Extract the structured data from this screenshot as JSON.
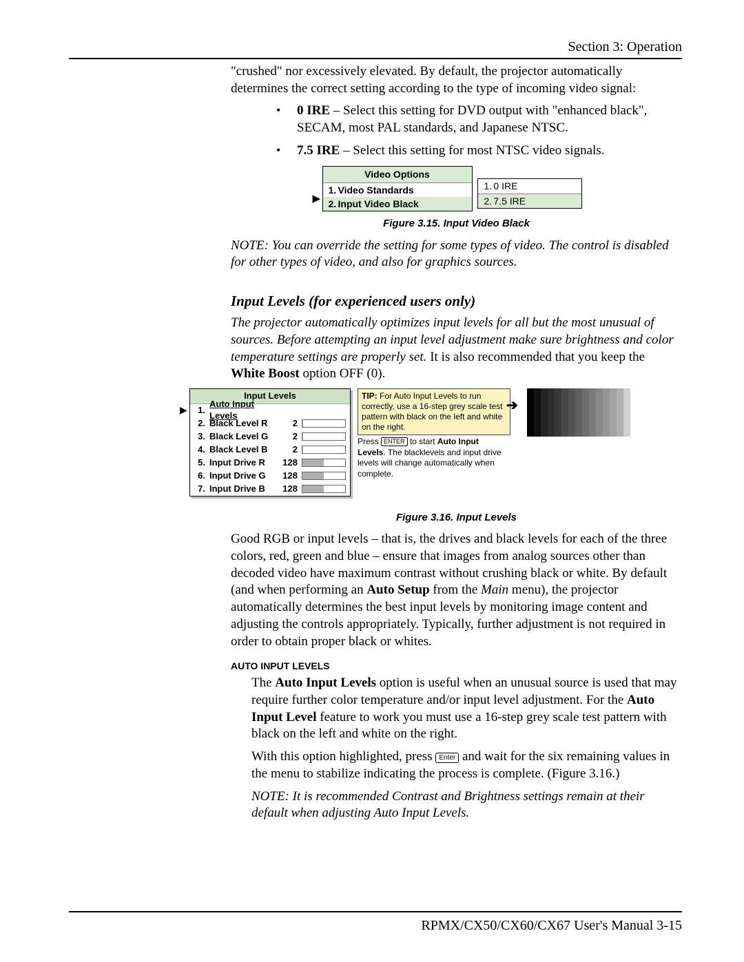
{
  "header": {
    "section": "Section 3: Operation"
  },
  "intro_para": "\"crushed\" nor excessively elevated. By default, the projector automatically determines the correct setting according to the type of incoming video signal:",
  "bullets": [
    {
      "lead": "0 IRE",
      "rest": " – Select this setting for DVD output with \"enhanced black\", SECAM, most PAL standards, and Japanese NTSC."
    },
    {
      "lead": "7.5 IRE",
      "rest": " – Select this setting for most NTSC video signals."
    }
  ],
  "video_options_menu": {
    "title": "Video Options",
    "rows": [
      {
        "n": "1.",
        "label": "Video Standards"
      },
      {
        "n": "2.",
        "label": "Input Video Black"
      }
    ],
    "submenu": [
      {
        "n": "1.",
        "label": "0 IRE"
      },
      {
        "n": "2.",
        "label": "7.5 IRE"
      }
    ]
  },
  "fig315_caption": "Figure 3.15. Input Video Black",
  "note1": "NOTE: You can override the setting for some types of video. The control is disabled for other types of video, and also for graphics sources.",
  "heading_input_levels": "Input Levels (for experienced users only)",
  "il_para_it": "The projector automatically optimizes input levels for all but the most unusual of sources. Before attempting an input level adjustment make sure brightness and color temperature settings are properly set.",
  "il_para_rest_a": " It is also recommended that you keep the ",
  "il_para_bold": "White Boost",
  "il_para_rest_b": " option OFF (0).",
  "input_levels_menu": {
    "title": "Input Levels",
    "rows": [
      {
        "n": "1.",
        "label": "Auto Input Levels",
        "val": "",
        "fill": 0
      },
      {
        "n": "2.",
        "label": "Black Level R",
        "val": "2",
        "fill": 2
      },
      {
        "n": "3.",
        "label": "Black Level G",
        "val": "2",
        "fill": 2
      },
      {
        "n": "4.",
        "label": "Black Level B",
        "val": "2",
        "fill": 2
      },
      {
        "n": "5.",
        "label": "Input Drive R",
        "val": "128",
        "fill": 50
      },
      {
        "n": "6.",
        "label": "Input Drive G",
        "val": "128",
        "fill": 50
      },
      {
        "n": "7.",
        "label": "Input Drive B",
        "val": "128",
        "fill": 50
      }
    ]
  },
  "tip_lead": "TIP:",
  "tip_rest": " For Auto Input Levels to run correctly, use a 16-step grey scale test pattern with black on the left and white on the right.",
  "il_note_a": "Press ",
  "il_note_enter": "ENTER",
  "il_note_b": " to start ",
  "il_note_bold": "Auto Input Levels",
  "il_note_c": ". The blacklevels and input drive levels will change automatically when complete.",
  "fig316_caption": "Figure 3.16. Input Levels",
  "good_rgb_a": "Good RGB or input levels – that is, the drives and black levels for each of the three colors, red, green and blue – ensure that images from analog sources other than decoded video have maximum contrast without crushing black or white. By default (and when performing an ",
  "good_rgb_b1": "Auto Setup",
  "good_rgb_b": " from the ",
  "good_rgb_b2": "Main",
  "good_rgb_c": " menu), the projector automatically determines the best input levels by monitoring image content and adjusting the controls appropriately. Typically, further adjustment is not required in order to obtain proper black or whites.",
  "auto_heading": "AUTO INPUT LEVELS",
  "auto_p1_a": "The ",
  "auto_p1_b": "Auto Input Levels",
  "auto_p1_c": " option is useful when an unusual source is used that may require further color temperature and/or input level adjustment. For the ",
  "auto_p1_d": "Auto Input Level",
  "auto_p1_e": " feature to work you must use a 16-step grey scale test pattern with black on the left and white on the right.",
  "auto_p2_a": "With this option highlighted, press ",
  "auto_p2_key": "Enter",
  "auto_p2_b": " and wait for the six remaining values in the menu to stabilize indicating the process is complete. (Figure 3.16.)",
  "auto_note": "NOTE: It is recommended Contrast and Brightness settings remain at their default when adjusting Auto Input Levels.",
  "footer": "RPMX/CX50/CX60/CX67 User's Manual  3-15",
  "grad_colors": [
    "#000",
    "#111",
    "#222",
    "#2e2e2e",
    "#3a3a3a",
    "#474747",
    "#545454",
    "#616161",
    "#6e6e6e",
    "#7b7b7b",
    "#888",
    "#959595",
    "#a3a3a3",
    "#b1b1b1",
    "#cfcfcf",
    "#fff"
  ]
}
